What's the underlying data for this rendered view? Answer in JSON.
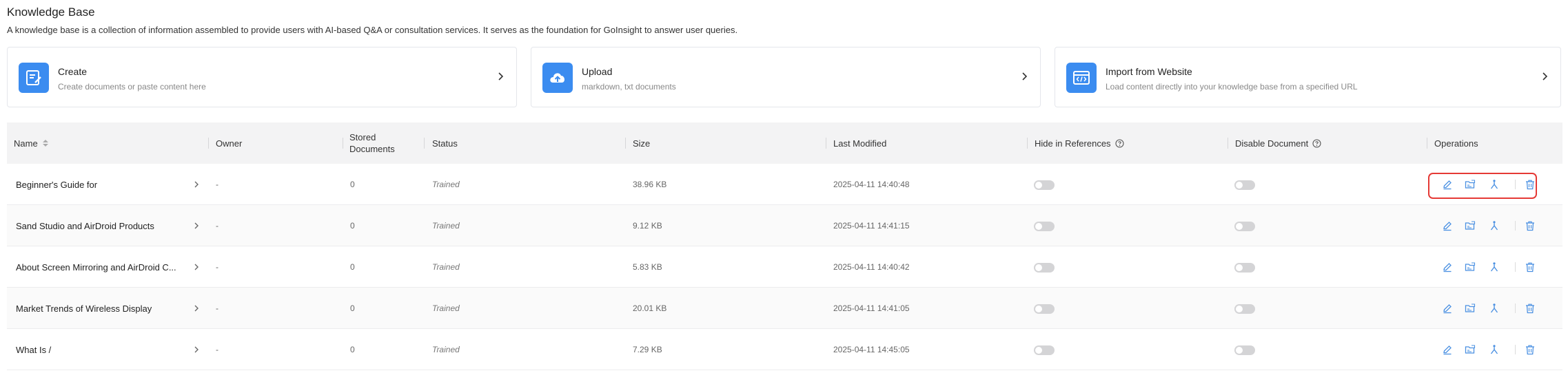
{
  "header": {
    "title": "Knowledge Base",
    "description": "A knowledge base is a collection of information assembled to provide users with AI-based Q&A or consultation services. It serves as the foundation for GoInsight to answer user queries."
  },
  "cards": [
    {
      "title": "Create",
      "subtitle": "Create documents or paste content here",
      "icon": "edit-document-icon"
    },
    {
      "title": "Upload",
      "subtitle": "markdown, txt documents",
      "icon": "cloud-upload-icon"
    },
    {
      "title": "Import from Website",
      "subtitle": "Load content directly into your knowledge base from a specified URL",
      "icon": "web-code-icon"
    }
  ],
  "table": {
    "headers": {
      "name": "Name",
      "owner": "Owner",
      "stored_line1": "Stored",
      "stored_line2": "Documents",
      "status": "Status",
      "size": "Size",
      "last_modified": "Last Modified",
      "hide_in_references": "Hide in References",
      "disable_document": "Disable Document",
      "operations": "Operations"
    },
    "rows": [
      {
        "name": "Beginner's Guide for",
        "owner": "-",
        "stored": "0",
        "status": "Trained",
        "size": "38.96 KB",
        "modified": "2025-04-11 14:40:48"
      },
      {
        "name": "Sand Studio and AirDroid Products",
        "owner": "-",
        "stored": "0",
        "status": "Trained",
        "size": "9.12 KB",
        "modified": "2025-04-11 14:41:15"
      },
      {
        "name": "About Screen Mirroring and AirDroid C...",
        "owner": "-",
        "stored": "0",
        "status": "Trained",
        "size": "5.83 KB",
        "modified": "2025-04-11 14:40:42"
      },
      {
        "name": "Market Trends of Wireless Display",
        "owner": "-",
        "stored": "0",
        "status": "Trained",
        "size": "20.01 KB",
        "modified": "2025-04-11 14:41:05"
      },
      {
        "name": "What Is /",
        "owner": "-",
        "stored": "0",
        "status": "Trained",
        "size": "7.29 KB",
        "modified": "2025-04-11 14:45:05"
      }
    ]
  },
  "colors": {
    "accent": "#3b8cf0",
    "highlight": "#e53935",
    "op_icon": "#4a90e2"
  }
}
